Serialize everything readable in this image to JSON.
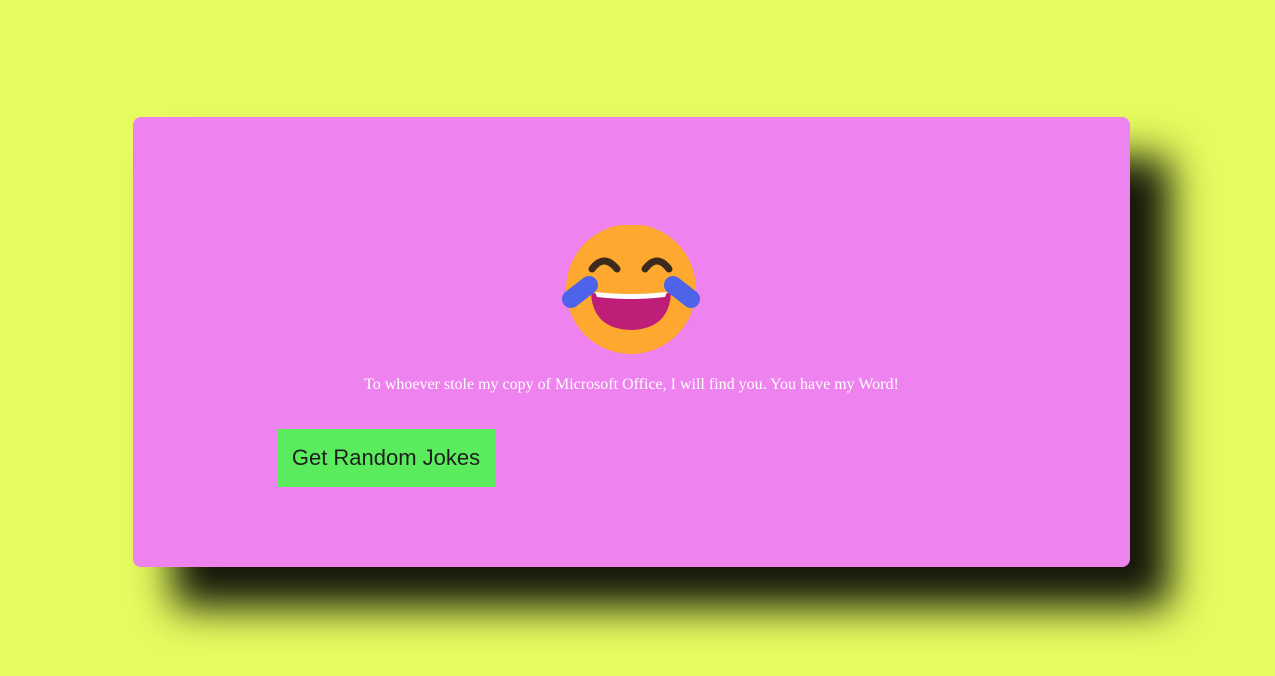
{
  "colors": {
    "page_background": "#e5fb5f",
    "card_background": "#ee82ee",
    "button_background": "#5bec5e",
    "joke_text": "#ffffff"
  },
  "emoji": {
    "icon": "face-with-tears-of-joy-icon"
  },
  "joke": {
    "text": "To whoever stole my copy of Microsoft Office, I will find you. You have my Word!"
  },
  "button": {
    "label": "Get Random Jokes"
  }
}
